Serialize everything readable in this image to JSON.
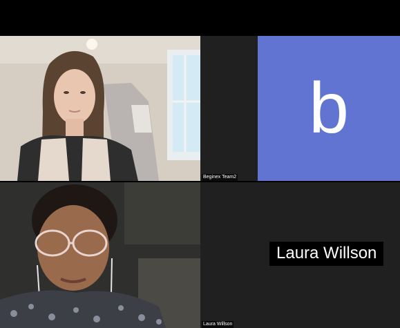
{
  "participants": [
    {
      "name": "",
      "video": true
    },
    {
      "name": "Beginex Team2",
      "avatar_letter": "b",
      "avatar_color": "#6174d1",
      "video": false
    },
    {
      "name": "",
      "video": true
    },
    {
      "name": "Laura Willson",
      "display_name": "Laura Willson",
      "video": false
    }
  ],
  "colors": {
    "background": "#000000",
    "tile_background": "#202020",
    "avatar": "#6174d1",
    "label_text": "#ffffff"
  },
  "icons": [
    "avatar-initial"
  ]
}
